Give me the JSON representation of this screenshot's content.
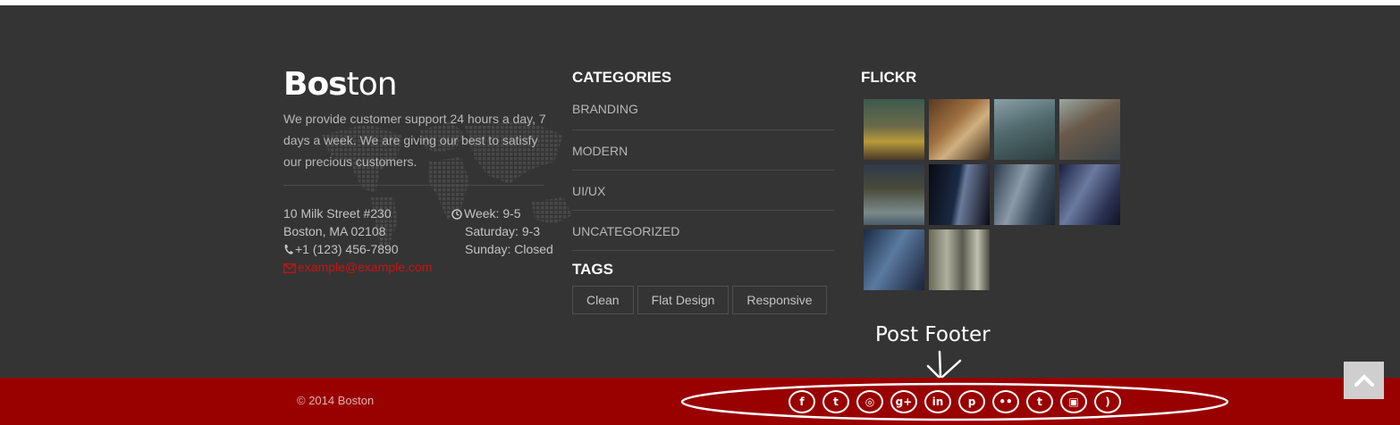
{
  "brand": {
    "bold": "Bos",
    "light": "ton"
  },
  "about": "We provide customer support 24 hours a day, 7 days a week. We are giving our best to satisfy our precious customers.",
  "address": {
    "street": "10 Milk Street #230",
    "city": "Boston, MA 02108",
    "phone": "+1 (123) 456-7890",
    "email": "example@example.com"
  },
  "hours": {
    "week": "Week: 9-5",
    "saturday": "Saturday: 9-3",
    "sunday": "Sunday: Closed"
  },
  "categories": {
    "heading": "CATEGORIES",
    "items": [
      "BRANDING",
      "MODERN",
      "UI/UX",
      "UNCATEGORIZED"
    ]
  },
  "tags": {
    "heading": "TAGS",
    "items": [
      "Clean",
      "Flat Design",
      "Responsive"
    ]
  },
  "flickr": {
    "heading": "FLICKR",
    "photo_count": 10
  },
  "annotation": "Post Footer",
  "copyright": "© 2014 Boston",
  "socials": [
    {
      "name": "facebook-icon",
      "glyph": "f"
    },
    {
      "name": "twitter-icon",
      "glyph": "t"
    },
    {
      "name": "dribbble-icon",
      "glyph": "◎"
    },
    {
      "name": "google-plus-icon",
      "glyph": "g+"
    },
    {
      "name": "linkedin-icon",
      "glyph": "in"
    },
    {
      "name": "pinterest-icon",
      "glyph": "p"
    },
    {
      "name": "flickr-icon",
      "glyph": "••"
    },
    {
      "name": "tumblr-icon",
      "glyph": "t"
    },
    {
      "name": "instagram-icon",
      "glyph": "▣"
    },
    {
      "name": "rss-icon",
      "glyph": ")"
    }
  ],
  "colors": {
    "footer_bg": "#343434",
    "bar_bg": "#990000",
    "accent": "#cc1111"
  }
}
